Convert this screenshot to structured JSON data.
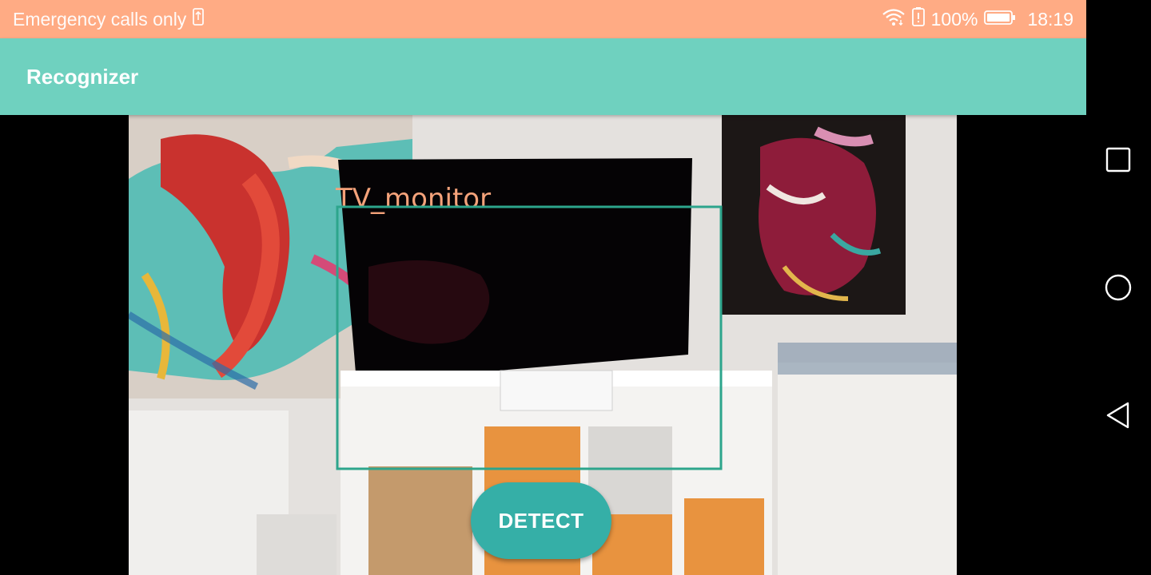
{
  "status_bar": {
    "carrier_text": "Emergency calls only",
    "battery_percent": "100%",
    "time": "18:19",
    "background_color": "#FFAB84",
    "icons": [
      "sim-icon",
      "wifi-icon",
      "battery-alert-icon",
      "battery-icon"
    ]
  },
  "app_bar": {
    "title": "Recognizer",
    "background_color": "#6FD1BF"
  },
  "detection": {
    "label": "TV_monitor",
    "label_color": "#F4A27A",
    "box_color": "#2DA58C"
  },
  "detect_button": {
    "label": "DETECT",
    "background_color": "#35AFA7"
  },
  "nav_bar": {
    "icons": [
      "recents-square-icon",
      "home-circle-icon",
      "back-triangle-icon"
    ]
  }
}
